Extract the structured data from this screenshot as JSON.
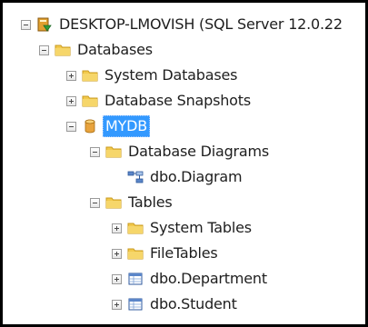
{
  "tree": {
    "server": {
      "label": "DESKTOP-LMOVISH (SQL Server 12.0.22",
      "icon": "server-icon",
      "state": "expanded"
    },
    "databases": {
      "label": "Databases",
      "icon": "folder-icon",
      "state": "expanded"
    },
    "system_databases": {
      "label": "System Databases",
      "icon": "folder-icon",
      "state": "collapsed"
    },
    "database_snapshots": {
      "label": "Database Snapshots",
      "icon": "folder-icon",
      "state": "collapsed"
    },
    "mydb": {
      "label": "MYDB",
      "icon": "database-icon",
      "state": "expanded",
      "selected": true
    },
    "database_diagrams": {
      "label": "Database Diagrams",
      "icon": "folder-icon",
      "state": "expanded"
    },
    "dbo_diagram": {
      "label": "dbo.Diagram",
      "icon": "diagram-icon"
    },
    "tables": {
      "label": "Tables",
      "icon": "folder-icon",
      "state": "expanded"
    },
    "system_tables": {
      "label": "System Tables",
      "icon": "folder-icon",
      "state": "collapsed"
    },
    "filetables": {
      "label": "FileTables",
      "icon": "folder-icon",
      "state": "collapsed"
    },
    "dbo_department": {
      "label": "dbo.Department",
      "icon": "table-icon",
      "state": "collapsed"
    },
    "dbo_student": {
      "label": "dbo.Student",
      "icon": "table-icon",
      "state": "collapsed"
    }
  },
  "colors": {
    "selection": "#3399ff",
    "folder": "#f2c94c",
    "database": "#e8a33d",
    "server_green": "#2e9a3a",
    "table": "#5b86c9"
  }
}
